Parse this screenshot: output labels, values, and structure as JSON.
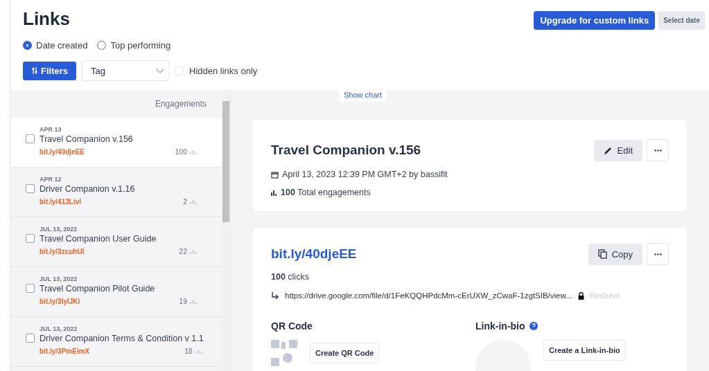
{
  "header": {
    "title": "Links",
    "upgrade_button": "Upgrade for custom links",
    "date_button": "Select date"
  },
  "sort_options": [
    {
      "label": "Date created",
      "selected": true
    },
    {
      "label": "Top performing",
      "selected": false
    }
  ],
  "filters": {
    "filters_button": "Filters",
    "tag_select": "Tag",
    "hidden_only": {
      "label": "Hidden links only",
      "checked": false
    }
  },
  "list": {
    "column_header": "Engagements",
    "items": [
      {
        "date": "APR 13",
        "title": "Travel Companion v.156",
        "short_link": "bit.ly/40djeEE",
        "engagements": "100",
        "selected": true,
        "checked": false
      },
      {
        "date": "APR 12",
        "title": "Driver Companion v.1.16",
        "short_link": "bit.ly/413Livl",
        "engagements": "2",
        "selected": false,
        "checked": false
      },
      {
        "date": "JUL 13, 2022",
        "title": "Travel Companion User Guide",
        "short_link": "bit.ly/3zcuhUI",
        "engagements": "22",
        "selected": false,
        "checked": false
      },
      {
        "date": "JUL 13, 2022",
        "title": "Travel Companion Pilot Guide",
        "short_link": "bit.ly/3lyIJKi",
        "engagements": "19",
        "selected": false,
        "checked": false
      },
      {
        "date": "JUL 13, 2022",
        "title": "Driver Companion Terms & Condition v 1.1",
        "short_link": "bit.ly/3PmEimX",
        "engagements": "18",
        "selected": false,
        "checked": false
      }
    ]
  },
  "show_chart": "Show chart",
  "detail": {
    "title": "Travel Companion v.156",
    "edit_button": "Edit",
    "created": "April 13, 2023 12:39 PM GMT+2 by bassifit",
    "engagements": "**100** Total engagements"
  },
  "link_card": {
    "short_link": "bit.ly/40djeEE",
    "copy_button": "Copy",
    "clicks": "**100** clicks",
    "destination": "https://drive.google.com/file/d/1FeKQQHPdcMm-cErUXW_zCwaF-1zgtSIB/view...",
    "redirect": "Redirect",
    "qr_title": "QR Code",
    "qr_button": "Create QR Code",
    "bio_title": "Link-in-bio",
    "bio_button": "Create a Link-in-bio"
  }
}
